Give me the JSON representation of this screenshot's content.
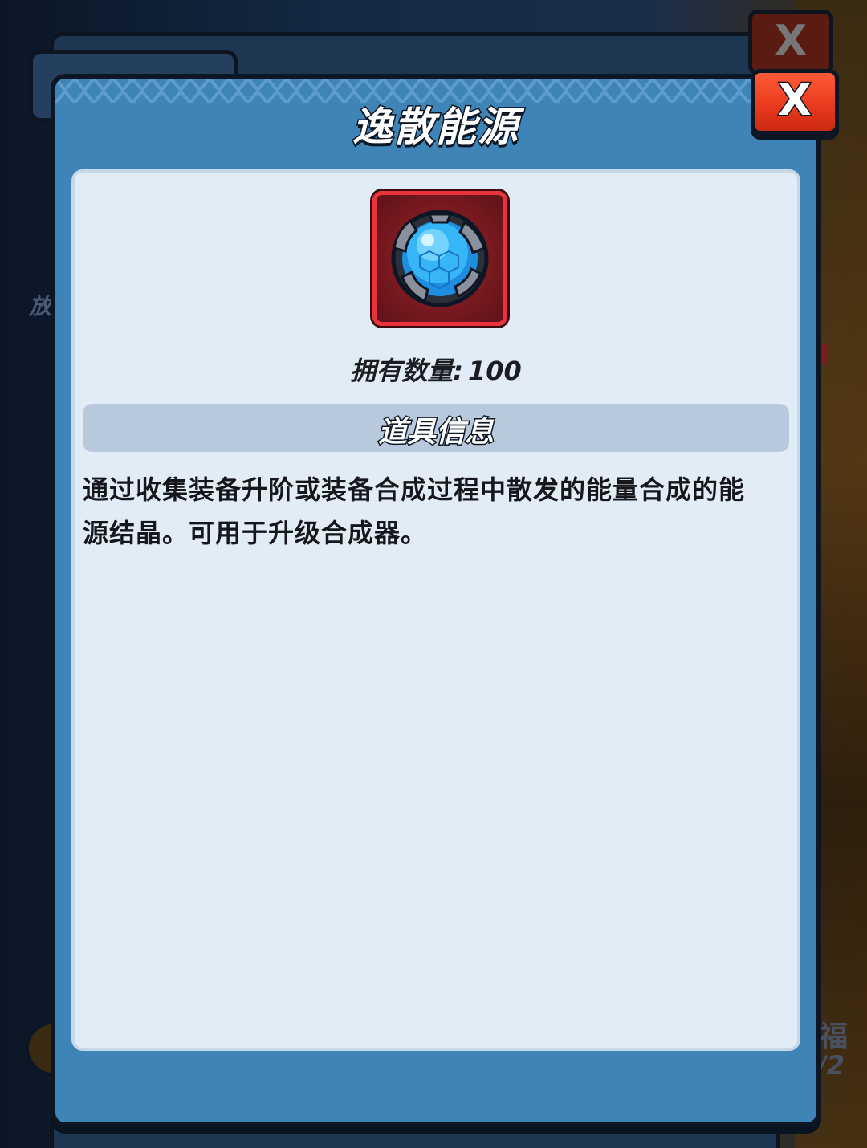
{
  "dialog": {
    "title": "逸散能源",
    "close_label": "X"
  },
  "item": {
    "icon": "energy-crystal-orb-icon",
    "owned_label": "拥有数量:",
    "owned_count": "100"
  },
  "info_section": {
    "title": "道具信息",
    "description": "通过收集装备升阶或装备合成过程中散发的能量合成的能源结晶。可用于升级合成器。"
  },
  "background": {
    "close_label": "X",
    "left_char": "放",
    "right_char": "福",
    "right_count": "/2"
  },
  "colors": {
    "dialog_blue": "#3f84b6",
    "content_bg": "#e2ecf6",
    "close_red": "#e8381c",
    "item_frame_red": "#e8323c",
    "crystal_blue": "#2aa8f0"
  }
}
